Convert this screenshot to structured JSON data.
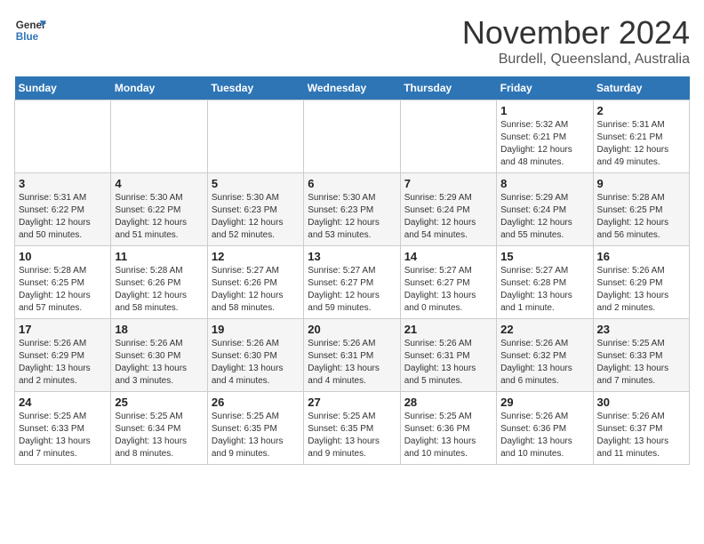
{
  "header": {
    "logo_line1": "General",
    "logo_line2": "Blue",
    "title": "November 2024",
    "subtitle": "Burdell, Queensland, Australia"
  },
  "weekdays": [
    "Sunday",
    "Monday",
    "Tuesday",
    "Wednesday",
    "Thursday",
    "Friday",
    "Saturday"
  ],
  "weeks": [
    [
      {
        "day": "",
        "info": ""
      },
      {
        "day": "",
        "info": ""
      },
      {
        "day": "",
        "info": ""
      },
      {
        "day": "",
        "info": ""
      },
      {
        "day": "",
        "info": ""
      },
      {
        "day": "1",
        "info": "Sunrise: 5:32 AM\nSunset: 6:21 PM\nDaylight: 12 hours and 48 minutes."
      },
      {
        "day": "2",
        "info": "Sunrise: 5:31 AM\nSunset: 6:21 PM\nDaylight: 12 hours and 49 minutes."
      }
    ],
    [
      {
        "day": "3",
        "info": "Sunrise: 5:31 AM\nSunset: 6:22 PM\nDaylight: 12 hours and 50 minutes."
      },
      {
        "day": "4",
        "info": "Sunrise: 5:30 AM\nSunset: 6:22 PM\nDaylight: 12 hours and 51 minutes."
      },
      {
        "day": "5",
        "info": "Sunrise: 5:30 AM\nSunset: 6:23 PM\nDaylight: 12 hours and 52 minutes."
      },
      {
        "day": "6",
        "info": "Sunrise: 5:30 AM\nSunset: 6:23 PM\nDaylight: 12 hours and 53 minutes."
      },
      {
        "day": "7",
        "info": "Sunrise: 5:29 AM\nSunset: 6:24 PM\nDaylight: 12 hours and 54 minutes."
      },
      {
        "day": "8",
        "info": "Sunrise: 5:29 AM\nSunset: 6:24 PM\nDaylight: 12 hours and 55 minutes."
      },
      {
        "day": "9",
        "info": "Sunrise: 5:28 AM\nSunset: 6:25 PM\nDaylight: 12 hours and 56 minutes."
      }
    ],
    [
      {
        "day": "10",
        "info": "Sunrise: 5:28 AM\nSunset: 6:25 PM\nDaylight: 12 hours and 57 minutes."
      },
      {
        "day": "11",
        "info": "Sunrise: 5:28 AM\nSunset: 6:26 PM\nDaylight: 12 hours and 58 minutes."
      },
      {
        "day": "12",
        "info": "Sunrise: 5:27 AM\nSunset: 6:26 PM\nDaylight: 12 hours and 58 minutes."
      },
      {
        "day": "13",
        "info": "Sunrise: 5:27 AM\nSunset: 6:27 PM\nDaylight: 12 hours and 59 minutes."
      },
      {
        "day": "14",
        "info": "Sunrise: 5:27 AM\nSunset: 6:27 PM\nDaylight: 13 hours and 0 minutes."
      },
      {
        "day": "15",
        "info": "Sunrise: 5:27 AM\nSunset: 6:28 PM\nDaylight: 13 hours and 1 minute."
      },
      {
        "day": "16",
        "info": "Sunrise: 5:26 AM\nSunset: 6:29 PM\nDaylight: 13 hours and 2 minutes."
      }
    ],
    [
      {
        "day": "17",
        "info": "Sunrise: 5:26 AM\nSunset: 6:29 PM\nDaylight: 13 hours and 2 minutes."
      },
      {
        "day": "18",
        "info": "Sunrise: 5:26 AM\nSunset: 6:30 PM\nDaylight: 13 hours and 3 minutes."
      },
      {
        "day": "19",
        "info": "Sunrise: 5:26 AM\nSunset: 6:30 PM\nDaylight: 13 hours and 4 minutes."
      },
      {
        "day": "20",
        "info": "Sunrise: 5:26 AM\nSunset: 6:31 PM\nDaylight: 13 hours and 4 minutes."
      },
      {
        "day": "21",
        "info": "Sunrise: 5:26 AM\nSunset: 6:31 PM\nDaylight: 13 hours and 5 minutes."
      },
      {
        "day": "22",
        "info": "Sunrise: 5:26 AM\nSunset: 6:32 PM\nDaylight: 13 hours and 6 minutes."
      },
      {
        "day": "23",
        "info": "Sunrise: 5:25 AM\nSunset: 6:33 PM\nDaylight: 13 hours and 7 minutes."
      }
    ],
    [
      {
        "day": "24",
        "info": "Sunrise: 5:25 AM\nSunset: 6:33 PM\nDaylight: 13 hours and 7 minutes."
      },
      {
        "day": "25",
        "info": "Sunrise: 5:25 AM\nSunset: 6:34 PM\nDaylight: 13 hours and 8 minutes."
      },
      {
        "day": "26",
        "info": "Sunrise: 5:25 AM\nSunset: 6:35 PM\nDaylight: 13 hours and 9 minutes."
      },
      {
        "day": "27",
        "info": "Sunrise: 5:25 AM\nSunset: 6:35 PM\nDaylight: 13 hours and 9 minutes."
      },
      {
        "day": "28",
        "info": "Sunrise: 5:25 AM\nSunset: 6:36 PM\nDaylight: 13 hours and 10 minutes."
      },
      {
        "day": "29",
        "info": "Sunrise: 5:26 AM\nSunset: 6:36 PM\nDaylight: 13 hours and 10 minutes."
      },
      {
        "day": "30",
        "info": "Sunrise: 5:26 AM\nSunset: 6:37 PM\nDaylight: 13 hours and 11 minutes."
      }
    ]
  ]
}
